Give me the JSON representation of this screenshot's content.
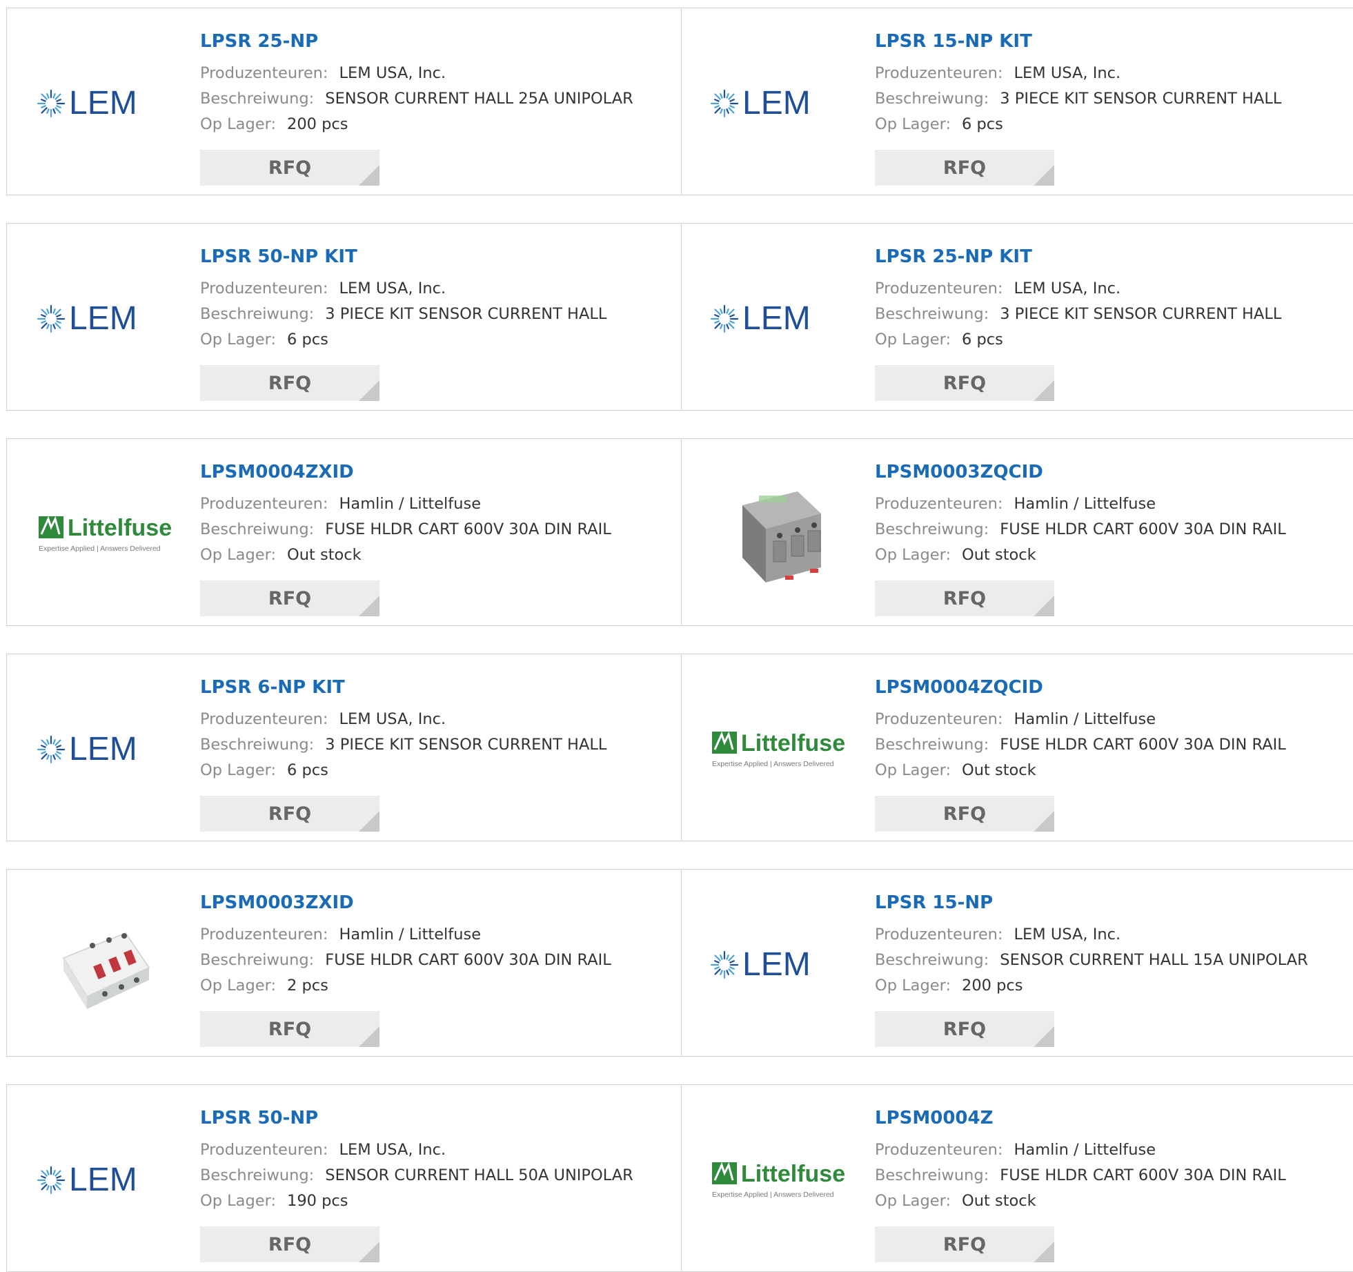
{
  "labels": {
    "manufacturer": "Produzenteuren:",
    "description": "Beschreiwung:",
    "stock": "Op Lager:",
    "rfq": "RFQ"
  },
  "brands": {
    "lem": {
      "text": "LEM",
      "color": "#1f4e96",
      "accent": "#4aa3df"
    },
    "littelfuse": {
      "text": "Littelfuse",
      "tagline": "Expertise Applied | Answers Delivered",
      "color": "#2f8a3c"
    }
  },
  "products": [
    {
      "part": "LPSR 25-NP",
      "manufacturer": "LEM USA, Inc.",
      "description": "SENSOR CURRENT HALL 25A UNIPOLAR",
      "stock": "200 pcs",
      "image": "lem-logo"
    },
    {
      "part": "LPSR 15-NP KIT",
      "manufacturer": "LEM USA, Inc.",
      "description": "3 PIECE KIT SENSOR CURRENT HALL",
      "stock": "6 pcs",
      "image": "lem-logo"
    },
    {
      "part": "LPSR 50-NP KIT",
      "manufacturer": "LEM USA, Inc.",
      "description": "3 PIECE KIT SENSOR CURRENT HALL",
      "stock": "6 pcs",
      "image": "lem-logo"
    },
    {
      "part": "LPSR 25-NP KIT",
      "manufacturer": "LEM USA, Inc.",
      "description": "3 PIECE KIT SENSOR CURRENT HALL",
      "stock": "6 pcs",
      "image": "lem-logo"
    },
    {
      "part": "LPSM0004ZXID",
      "manufacturer": "Hamlin / Littelfuse",
      "description": "FUSE HLDR CART 600V 30A DIN RAIL",
      "stock": "Out stock",
      "image": "littelfuse-logo"
    },
    {
      "part": "LPSM0003ZQCID",
      "manufacturer": "Hamlin / Littelfuse",
      "description": "FUSE HLDR CART 600V 30A DIN RAIL",
      "stock": "Out stock",
      "image": "fuse-holder-gray-photo"
    },
    {
      "part": "LPSR 6-NP KIT",
      "manufacturer": "LEM USA, Inc.",
      "description": "3 PIECE KIT SENSOR CURRENT HALL",
      "stock": "6 pcs",
      "image": "lem-logo"
    },
    {
      "part": "LPSM0004ZQCID",
      "manufacturer": "Hamlin / Littelfuse",
      "description": "FUSE HLDR CART 600V 30A DIN RAIL",
      "stock": "Out stock",
      "image": "littelfuse-logo"
    },
    {
      "part": "LPSM0003ZXID",
      "manufacturer": "Hamlin / Littelfuse",
      "description": "FUSE HLDR CART 600V 30A DIN RAIL",
      "stock": "2 pcs",
      "image": "fuse-holder-white-photo"
    },
    {
      "part": "LPSR 15-NP",
      "manufacturer": "LEM USA, Inc.",
      "description": "SENSOR CURRENT HALL 15A UNIPOLAR",
      "stock": "200 pcs",
      "image": "lem-logo"
    },
    {
      "part": "LPSR 50-NP",
      "manufacturer": "LEM USA, Inc.",
      "description": "SENSOR CURRENT HALL 50A UNIPOLAR",
      "stock": "190 pcs",
      "image": "lem-logo"
    },
    {
      "part": "LPSM0004Z",
      "manufacturer": "Hamlin / Littelfuse",
      "description": "FUSE HLDR CART 600V 30A DIN RAIL",
      "stock": "Out stock",
      "image": "littelfuse-logo"
    }
  ]
}
